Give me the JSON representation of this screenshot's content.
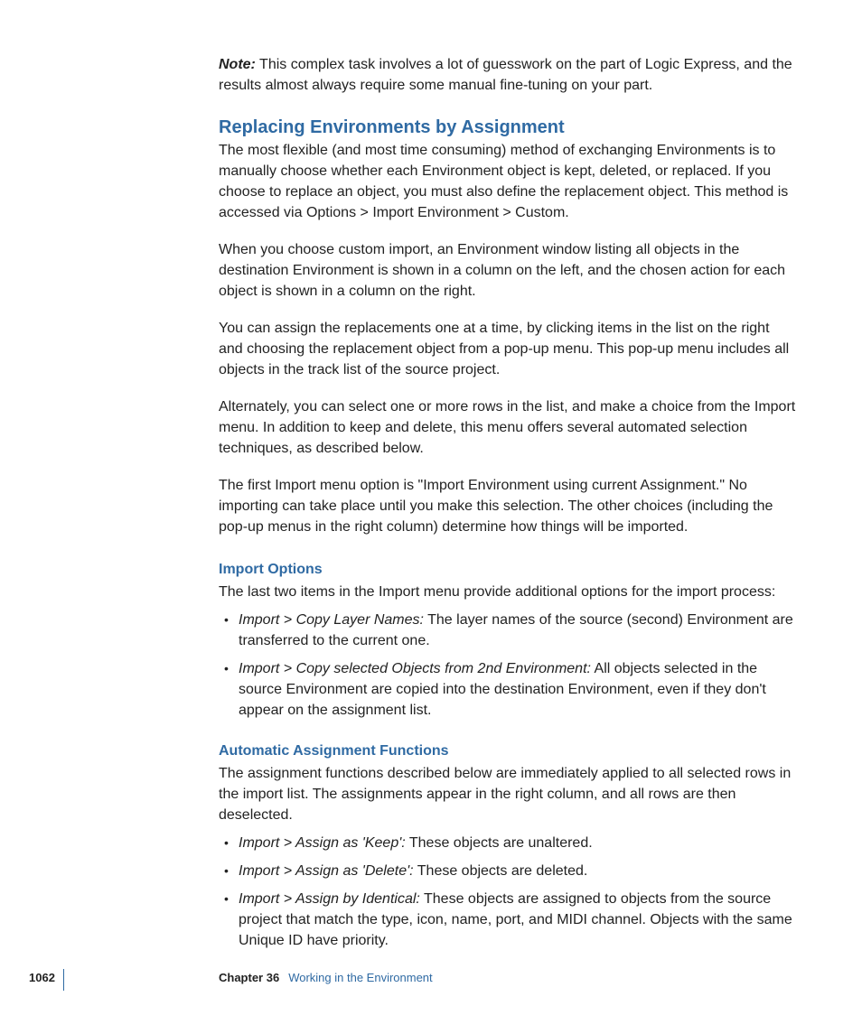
{
  "note": {
    "label": "Note:",
    "text": " This complex task involves a lot of guesswork on the part of Logic Express, and the results almost always require some manual fine-tuning on your part."
  },
  "section1": {
    "heading": "Replacing Environments by Assignment",
    "p1": "The most flexible (and most time consuming) method of exchanging Environments is to manually choose whether each Environment object is kept, deleted, or replaced. If you choose to replace an object, you must also define the replacement object. This method is accessed via Options > Import Environment > Custom.",
    "p2": "When you choose custom import, an Environment window listing all objects in the destination Environment is shown in a column on the left, and the chosen action for each object is shown in a column on the right.",
    "p3": "You can assign the replacements one at a time, by clicking items in the list on the right and choosing the replacement object from a pop-up menu. This pop-up menu includes all objects in the track list of the source project.",
    "p4": "Alternately, you can select one or more rows in the list, and make a choice from the Import menu. In addition to keep and delete, this menu offers several automated selection techniques, as described below.",
    "p5": "The first Import menu option is \"Import Environment using current Assignment.\" No importing can take place until you make this selection. The other choices (including the pop-up menus in the right column) determine how things will be imported."
  },
  "section2": {
    "heading": "Import Options",
    "intro": "The last two items in the Import menu provide additional options for the import process:",
    "items": [
      {
        "label": "Import > Copy Layer Names:",
        "text": " The layer names of the source (second) Environment are transferred to the current one."
      },
      {
        "label": "Import > Copy selected Objects from 2nd Environment:",
        "text": " All objects selected in the source Environment are copied into the destination Environment, even if they don't appear on the assignment list."
      }
    ]
  },
  "section3": {
    "heading": "Automatic Assignment Functions",
    "intro": "The assignment functions described below are immediately applied to all selected rows in the import list. The assignments appear in the right column, and all rows are then deselected.",
    "items": [
      {
        "label": "Import > Assign as 'Keep':",
        "text": " These objects are unaltered."
      },
      {
        "label": "Import > Assign as 'Delete':",
        "text": " These objects are deleted."
      },
      {
        "label": "Import > Assign by Identical:",
        "text": " These objects are assigned to objects from the source project that match the type, icon, name, port, and MIDI channel. Objects with the same Unique ID have priority."
      }
    ]
  },
  "footer": {
    "page": "1062",
    "chapterNum": "Chapter 36",
    "chapterTitle": "Working in the Environment"
  }
}
